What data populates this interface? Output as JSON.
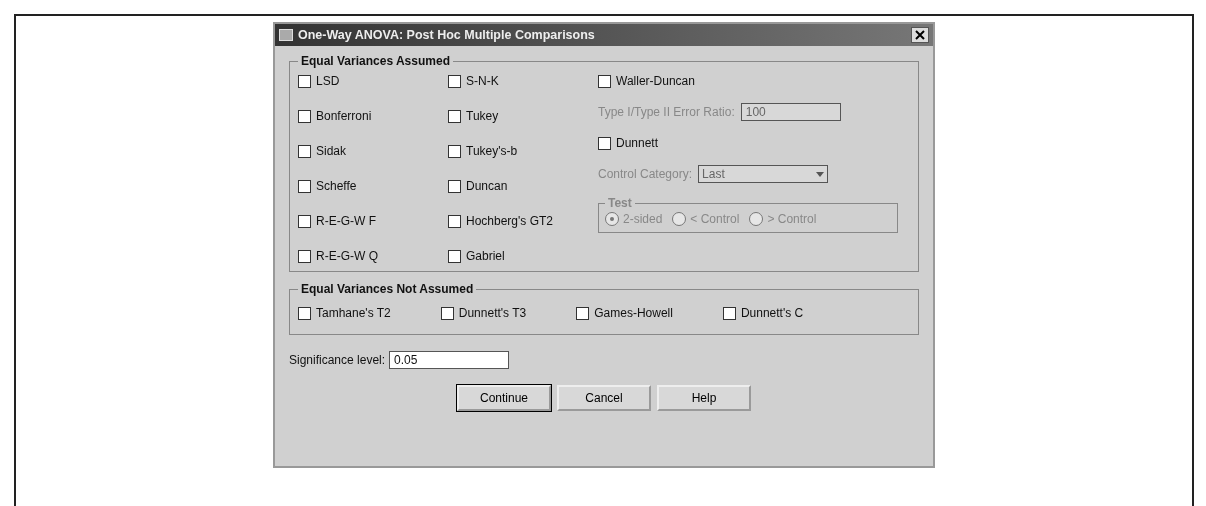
{
  "window": {
    "title": "One-Way ANOVA: Post Hoc Multiple Comparisons"
  },
  "equal_assumed": {
    "title": "Equal Variances Assumed",
    "column_1": [
      {
        "label": "LSD",
        "checked": false
      },
      {
        "label": "Bonferroni",
        "checked": false
      },
      {
        "label": "Sidak",
        "checked": false
      },
      {
        "label": "Scheffe",
        "checked": false
      },
      {
        "label": "R-E-G-W F",
        "checked": false
      },
      {
        "label": "R-E-G-W Q",
        "checked": false
      }
    ],
    "column_2": [
      {
        "label": "S-N-K",
        "checked": false
      },
      {
        "label": "Tukey",
        "checked": false
      },
      {
        "label": "Tukey's-b",
        "checked": false
      },
      {
        "label": "Duncan",
        "checked": false
      },
      {
        "label": "Hochberg's GT2",
        "checked": false
      },
      {
        "label": "Gabriel",
        "checked": false
      }
    ],
    "waller": {
      "label": "Waller-Duncan",
      "checked": false
    },
    "error_ratio": {
      "label": "Type I/Type II Error Ratio:",
      "value": "100",
      "disabled": true
    },
    "dunnett": {
      "label": "Dunnett",
      "checked": false
    },
    "control_category": {
      "label": "Control Category:",
      "value": "Last",
      "disabled": true
    },
    "test": {
      "title": "Test",
      "disabled": true,
      "options": [
        {
          "label": "2-sided",
          "selected": true
        },
        {
          "label": "< Control",
          "selected": false
        },
        {
          "label": "> Control",
          "selected": false
        }
      ]
    }
  },
  "equal_not_assumed": {
    "title": "Equal Variances Not Assumed",
    "items": [
      {
        "label": "Tamhane's T2",
        "checked": false
      },
      {
        "label": "Dunnett's T3",
        "checked": false
      },
      {
        "label": "Games-Howell",
        "checked": false
      },
      {
        "label": "Dunnett's C",
        "checked": false
      }
    ]
  },
  "significance": {
    "label": "Significance level:",
    "value": "0.05"
  },
  "buttons": [
    "Continue",
    "Cancel",
    "Help"
  ]
}
